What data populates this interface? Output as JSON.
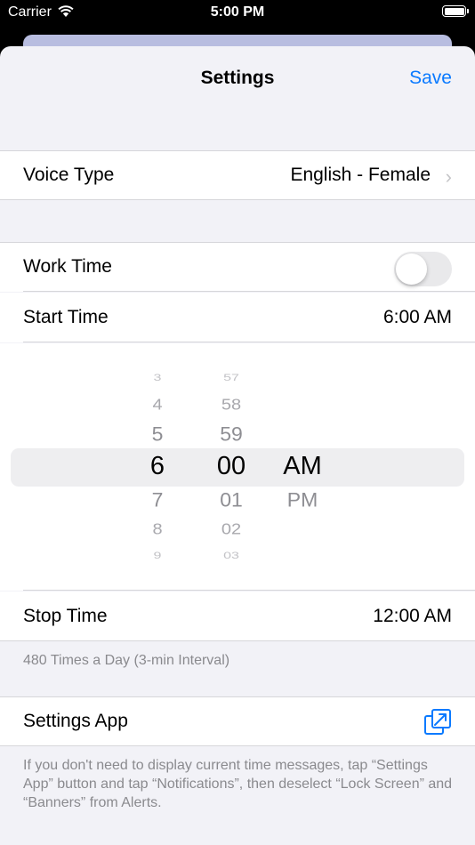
{
  "status_bar": {
    "carrier": "Carrier",
    "time": "5:00 PM"
  },
  "nav": {
    "title": "Settings",
    "save_label": "Save"
  },
  "voice": {
    "label": "Voice Type",
    "value": "English - Female"
  },
  "work_time": {
    "label": "Work Time",
    "enabled": false
  },
  "start_time": {
    "label": "Start Time",
    "value": "6:00 AM"
  },
  "picker": {
    "hours": [
      "3",
      "4",
      "5",
      "6",
      "7",
      "8",
      "9"
    ],
    "minutes": [
      "57",
      "58",
      "59",
      "00",
      "01",
      "02",
      "03"
    ],
    "periods": [
      "AM",
      "PM"
    ],
    "selected": {
      "hour": "6",
      "minute": "00",
      "period": "AM"
    }
  },
  "stop_time": {
    "label": "Stop Time",
    "value": "12:00 AM"
  },
  "interval_note": "480 Times a Day (3-min Interval)",
  "settings_app": {
    "label": "Settings App",
    "icon": "external-link-icon"
  },
  "footer_note": "If you don't need to display current time messages, tap “Settings App” button and tap “Notifications”, then deselect “Lock Screen” and “Banners” from Alerts.",
  "colors": {
    "accent": "#0a7aff",
    "background": "#f2f2f7",
    "toggle_off": "#e9e9eb"
  }
}
